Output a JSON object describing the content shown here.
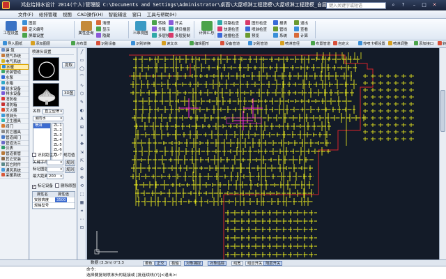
{
  "window": {
    "title": "鸿业给排水设计 2014(个人)管理版  C:\\Documents and Settings\\Administrator\\桌面\\大屋喷淋工程建模\\大屋喷淋工程建模_自层.dwg",
    "search_placeholder": "键入关键字或短语"
  },
  "menu": [
    "文件(F)",
    "给排管理",
    "视图",
    "CAD操作(H)",
    "智能辅设",
    "窗口",
    "工具与帮助(H)"
  ],
  "ribbon": {
    "big": [
      {
        "label": "工程设置",
        "color": "#3a72c4"
      },
      {
        "label": "属性查询",
        "color": "#c48a3a"
      },
      {
        "label": "三维视图",
        "color": "#3a9ac4"
      },
      {
        "label": "计算汇总",
        "color": "#4aa34a"
      }
    ],
    "small_groups": [
      [
        "图层",
        "定义编号",
        "屏幕设置"
      ],
      [
        "清理",
        "显示",
        "隐藏"
      ],
      [
        "转换",
        "升降",
        "多层移动"
      ],
      [
        "开关",
        "拷贝楼层",
        "多层复制"
      ],
      [
        "回路检查",
        "快速检查",
        "碰撞检查"
      ],
      [
        "图形检查",
        "喷淋检查",
        "预览"
      ],
      [
        "报表",
        "管线",
        "系统"
      ],
      [
        "退出",
        "查看",
        "计算"
      ]
    ]
  },
  "toolbar2": [
    "导入图纸",
    "添加图层",
    "点布置",
    "识别设备",
    "识别转换",
    "读文本",
    "编辑图形",
    "设备管道",
    "识别管道",
    "喷淋管径",
    "布置管道",
    "自定义",
    "传喷卡顿设置",
    "喷淋调整",
    "添加接口",
    "转换上下喷",
    "交叉识别"
  ],
  "nav": {
    "items": [
      {
        "label": "建 筑",
        "color": "#6b8fc7"
      },
      {
        "label": "燃气系统",
        "color": "#c77b3a"
      },
      {
        "label": "电气系统",
        "color": "#d8b520"
      },
      {
        "label": "水暖",
        "color": "#2f8ad8",
        "selected": true
      },
      {
        "label": "安装管道",
        "color": "#3aa86b"
      },
      {
        "label": "水泵",
        "color": "#2f6ad8"
      },
      {
        "label": "水箱",
        "color": "#2fa8c8"
      },
      {
        "label": "给水设备",
        "color": "#3a7ad8"
      },
      {
        "label": "排水设备",
        "color": "#7a5ad8"
      },
      {
        "label": "消防栓",
        "color": "#d83a3a"
      },
      {
        "label": "消防箱",
        "color": "#c83030"
      },
      {
        "label": "灭火器",
        "color": "#e04a2a"
      },
      {
        "label": "喷淋头",
        "color": "#3a9ad8"
      },
      {
        "label": "卫生器具",
        "color": "#2fb8b8"
      },
      {
        "label": "阀门",
        "color": "#d87a2f"
      },
      {
        "label": "其它器具",
        "color": "#8a8a8a"
      },
      {
        "label": "管道阀门",
        "color": "#4a7ac8"
      },
      {
        "label": "管道法兰",
        "color": "#6a6ac8"
      },
      {
        "label": "仪表",
        "color": "#2f9a6b"
      },
      {
        "label": "管道套管",
        "color": "#b87a3a"
      },
      {
        "label": "其它安装",
        "color": "#8a6a4a"
      },
      {
        "label": "其它附件",
        "color": "#5a8a8a"
      },
      {
        "label": "通风系统",
        "color": "#4a9ad8"
      },
      {
        "label": "采暖系统",
        "color": "#d85a3a"
      }
    ]
  },
  "panel": {
    "title": "喷淋头设置",
    "extract_button": "提取",
    "view_button": "3D图",
    "name_label": "名称",
    "name_value": "直立型喷",
    "type_value": "消防水",
    "list": [
      "喷淋",
      "ZL-1",
      "ZL-2",
      "ZL-3",
      "ZL-4",
      "ZL-5",
      "ZL-6",
      "ZL-7"
    ],
    "identify_label": "识别距注力",
    "rule_label": "规范值",
    "keyword_label": "关键字符",
    "keyword_btn": "规则",
    "block_label": "标记图层",
    "block_btn": "规则",
    "maxdist_label": "最大距离",
    "maxdist_value": "200",
    "mark_label": "标记设备",
    "delete_label": "删除原图",
    "prop_header": [
      "属性名",
      "属性值"
    ],
    "props": [
      {
        "name": "安装高度",
        "value": "3500"
      },
      {
        "name": "规格型号",
        "value": ""
      }
    ]
  },
  "status": {
    "coords": "数据 (3.3m) 0°3.3",
    "buttons": [
      {
        "label": "着色",
        "on": false
      },
      {
        "label": "正交",
        "on": true
      },
      {
        "label": "极轴",
        "on": false
      },
      {
        "label": "对象捕捉",
        "on": true
      },
      {
        "label": "对象追踪",
        "on": true
      },
      {
        "label": "线宽",
        "on": false
      },
      {
        "label": "组合开关",
        "on": false
      },
      {
        "label": "隔层开关",
        "on": true
      }
    ]
  },
  "command": {
    "line1": "命令:",
    "line2": "选择要复制喷淋头的链接或 [批连续线(Y)]<退出>:"
  },
  "drawing": {
    "pipe_color": "#f2f21e",
    "outline_color": "#d9232a",
    "highlight_color": "#ff2bd5",
    "background": "#131b28"
  }
}
